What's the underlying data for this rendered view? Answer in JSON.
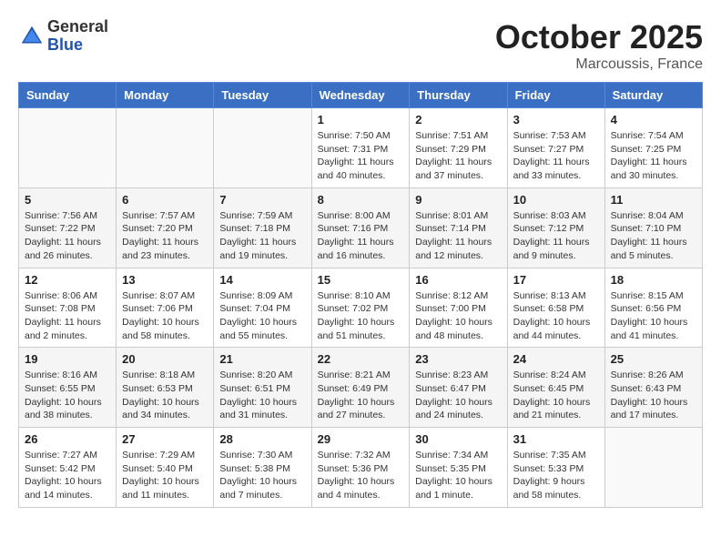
{
  "header": {
    "logo_general": "General",
    "logo_blue": "Blue",
    "month": "October 2025",
    "location": "Marcoussis, France"
  },
  "days_of_week": [
    "Sunday",
    "Monday",
    "Tuesday",
    "Wednesday",
    "Thursday",
    "Friday",
    "Saturday"
  ],
  "weeks": [
    [
      {
        "day": "",
        "detail": ""
      },
      {
        "day": "",
        "detail": ""
      },
      {
        "day": "",
        "detail": ""
      },
      {
        "day": "1",
        "detail": "Sunrise: 7:50 AM\nSunset: 7:31 PM\nDaylight: 11 hours\nand 40 minutes."
      },
      {
        "day": "2",
        "detail": "Sunrise: 7:51 AM\nSunset: 7:29 PM\nDaylight: 11 hours\nand 37 minutes."
      },
      {
        "day": "3",
        "detail": "Sunrise: 7:53 AM\nSunset: 7:27 PM\nDaylight: 11 hours\nand 33 minutes."
      },
      {
        "day": "4",
        "detail": "Sunrise: 7:54 AM\nSunset: 7:25 PM\nDaylight: 11 hours\nand 30 minutes."
      }
    ],
    [
      {
        "day": "5",
        "detail": "Sunrise: 7:56 AM\nSunset: 7:22 PM\nDaylight: 11 hours\nand 26 minutes."
      },
      {
        "day": "6",
        "detail": "Sunrise: 7:57 AM\nSunset: 7:20 PM\nDaylight: 11 hours\nand 23 minutes."
      },
      {
        "day": "7",
        "detail": "Sunrise: 7:59 AM\nSunset: 7:18 PM\nDaylight: 11 hours\nand 19 minutes."
      },
      {
        "day": "8",
        "detail": "Sunrise: 8:00 AM\nSunset: 7:16 PM\nDaylight: 11 hours\nand 16 minutes."
      },
      {
        "day": "9",
        "detail": "Sunrise: 8:01 AM\nSunset: 7:14 PM\nDaylight: 11 hours\nand 12 minutes."
      },
      {
        "day": "10",
        "detail": "Sunrise: 8:03 AM\nSunset: 7:12 PM\nDaylight: 11 hours\nand 9 minutes."
      },
      {
        "day": "11",
        "detail": "Sunrise: 8:04 AM\nSunset: 7:10 PM\nDaylight: 11 hours\nand 5 minutes."
      }
    ],
    [
      {
        "day": "12",
        "detail": "Sunrise: 8:06 AM\nSunset: 7:08 PM\nDaylight: 11 hours\nand 2 minutes."
      },
      {
        "day": "13",
        "detail": "Sunrise: 8:07 AM\nSunset: 7:06 PM\nDaylight: 10 hours\nand 58 minutes."
      },
      {
        "day": "14",
        "detail": "Sunrise: 8:09 AM\nSunset: 7:04 PM\nDaylight: 10 hours\nand 55 minutes."
      },
      {
        "day": "15",
        "detail": "Sunrise: 8:10 AM\nSunset: 7:02 PM\nDaylight: 10 hours\nand 51 minutes."
      },
      {
        "day": "16",
        "detail": "Sunrise: 8:12 AM\nSunset: 7:00 PM\nDaylight: 10 hours\nand 48 minutes."
      },
      {
        "day": "17",
        "detail": "Sunrise: 8:13 AM\nSunset: 6:58 PM\nDaylight: 10 hours\nand 44 minutes."
      },
      {
        "day": "18",
        "detail": "Sunrise: 8:15 AM\nSunset: 6:56 PM\nDaylight: 10 hours\nand 41 minutes."
      }
    ],
    [
      {
        "day": "19",
        "detail": "Sunrise: 8:16 AM\nSunset: 6:55 PM\nDaylight: 10 hours\nand 38 minutes."
      },
      {
        "day": "20",
        "detail": "Sunrise: 8:18 AM\nSunset: 6:53 PM\nDaylight: 10 hours\nand 34 minutes."
      },
      {
        "day": "21",
        "detail": "Sunrise: 8:20 AM\nSunset: 6:51 PM\nDaylight: 10 hours\nand 31 minutes."
      },
      {
        "day": "22",
        "detail": "Sunrise: 8:21 AM\nSunset: 6:49 PM\nDaylight: 10 hours\nand 27 minutes."
      },
      {
        "day": "23",
        "detail": "Sunrise: 8:23 AM\nSunset: 6:47 PM\nDaylight: 10 hours\nand 24 minutes."
      },
      {
        "day": "24",
        "detail": "Sunrise: 8:24 AM\nSunset: 6:45 PM\nDaylight: 10 hours\nand 21 minutes."
      },
      {
        "day": "25",
        "detail": "Sunrise: 8:26 AM\nSunset: 6:43 PM\nDaylight: 10 hours\nand 17 minutes."
      }
    ],
    [
      {
        "day": "26",
        "detail": "Sunrise: 7:27 AM\nSunset: 5:42 PM\nDaylight: 10 hours\nand 14 minutes."
      },
      {
        "day": "27",
        "detail": "Sunrise: 7:29 AM\nSunset: 5:40 PM\nDaylight: 10 hours\nand 11 minutes."
      },
      {
        "day": "28",
        "detail": "Sunrise: 7:30 AM\nSunset: 5:38 PM\nDaylight: 10 hours\nand 7 minutes."
      },
      {
        "day": "29",
        "detail": "Sunrise: 7:32 AM\nSunset: 5:36 PM\nDaylight: 10 hours\nand 4 minutes."
      },
      {
        "day": "30",
        "detail": "Sunrise: 7:34 AM\nSunset: 5:35 PM\nDaylight: 10 hours\nand 1 minute."
      },
      {
        "day": "31",
        "detail": "Sunrise: 7:35 AM\nSunset: 5:33 PM\nDaylight: 9 hours\nand 58 minutes."
      },
      {
        "day": "",
        "detail": ""
      }
    ]
  ]
}
